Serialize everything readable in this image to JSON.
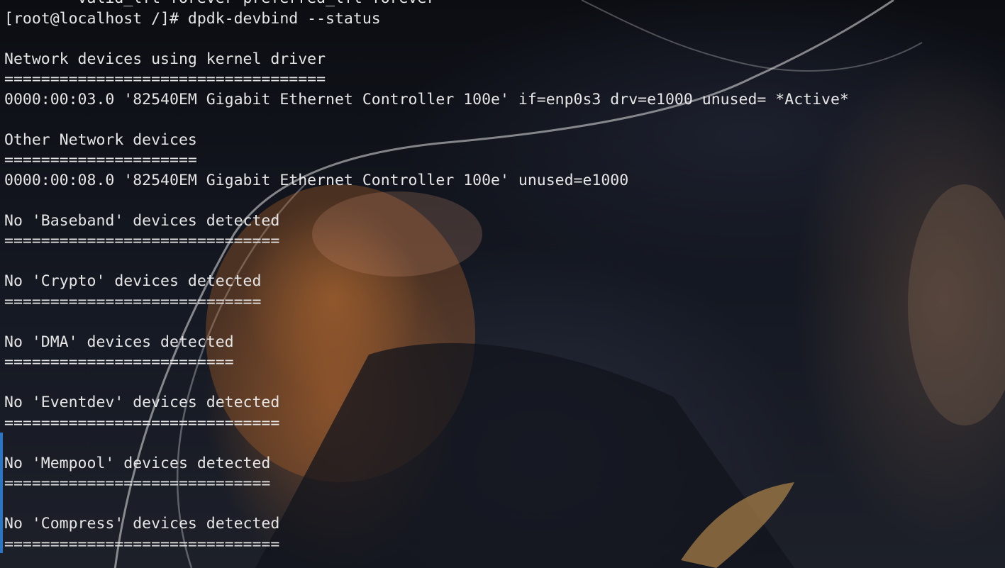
{
  "terminal": {
    "lines": [
      "        valid_lft forever preferred_lft forever",
      "[root@localhost /]# dpdk-devbind --status",
      "",
      "Network devices using kernel driver",
      "===================================",
      "0000:00:03.0 '82540EM Gigabit Ethernet Controller 100e' if=enp0s3 drv=e1000 unused= *Active*",
      "",
      "Other Network devices",
      "=====================",
      "0000:00:08.0 '82540EM Gigabit Ethernet Controller 100e' unused=e1000",
      "",
      "No 'Baseband' devices detected",
      "==============================",
      "",
      "No 'Crypto' devices detected",
      "============================",
      "",
      "No 'DMA' devices detected",
      "=========================",
      "",
      "No 'Eventdev' devices detected",
      "==============================",
      "",
      "No 'Mempool' devices detected",
      "=============================",
      "",
      "No 'Compress' devices detected",
      "=============================="
    ]
  },
  "colors": {
    "text": "#e6e6e6",
    "selection_bar": "#2a76c4",
    "background": "#0c0f16"
  }
}
